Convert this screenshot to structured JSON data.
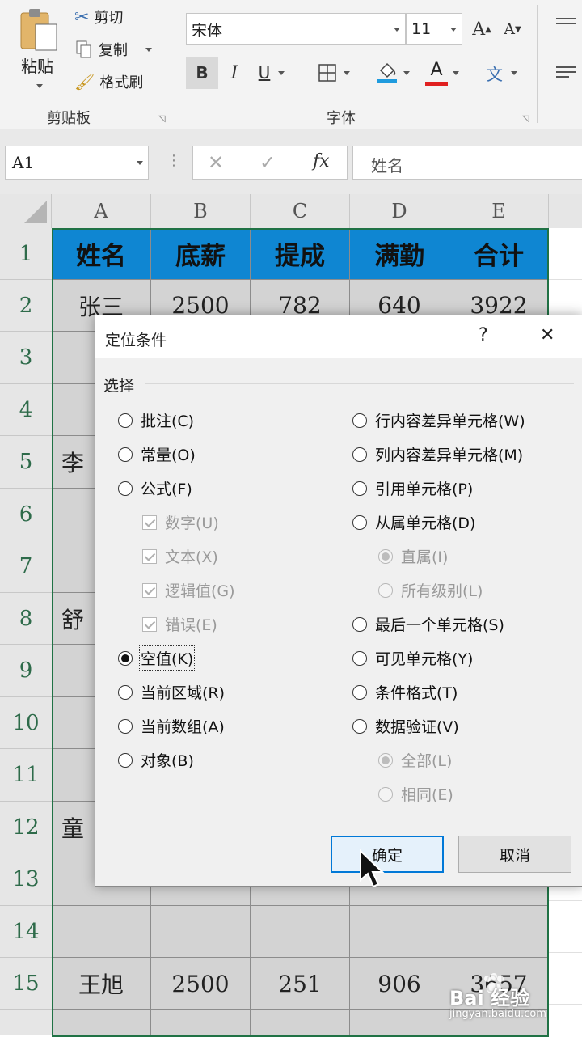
{
  "ribbon": {
    "clipboard": {
      "paste_label": "粘贴",
      "cut_label": "剪切",
      "copy_label": "复制",
      "format_painter_label": "格式刷",
      "group_label": "剪贴板"
    },
    "font": {
      "font_name": "宋体",
      "font_size": "11",
      "grow_label": "A",
      "shrink_label": "A",
      "bold_label": "B",
      "italic_label": "I",
      "underline_label": "U",
      "font_color_label": "A",
      "phonetic_label": "文",
      "group_label": "字体"
    }
  },
  "formula_bar": {
    "name_box": "A1",
    "fx_label": "fx",
    "content": "姓名"
  },
  "sheet": {
    "columns": [
      "A",
      "B",
      "C",
      "D",
      "E"
    ],
    "rows": [
      "1",
      "2",
      "3",
      "4",
      "5",
      "6",
      "7",
      "8",
      "9",
      "10",
      "11",
      "12",
      "13",
      "14",
      "15"
    ],
    "header_cells": [
      "姓名",
      "底薪",
      "提成",
      "满勤",
      "合计"
    ],
    "visible_cells": {
      "r2": [
        "张三",
        "2500",
        "782",
        "640",
        "3922"
      ],
      "r5a": "李",
      "r8a": "舒",
      "r12a": "童",
      "r15": [
        "王旭",
        "2500",
        "251",
        "906",
        "3657"
      ]
    },
    "colors": {
      "header_fill": "#0f86d2",
      "selection_fill": "#d3d3d3",
      "selection_border": "#207245"
    }
  },
  "dialog": {
    "title": "定位条件",
    "help_label": "?",
    "close_label": "✕",
    "section_label": "选择",
    "left_options": [
      {
        "label": "批注(C)",
        "selected": false
      },
      {
        "label": "常量(O)",
        "selected": false
      },
      {
        "label": "公式(F)",
        "selected": false
      },
      {
        "label": "数字(U)",
        "checked": true,
        "disabled": true
      },
      {
        "label": "文本(X)",
        "checked": true,
        "disabled": true
      },
      {
        "label": "逻辑值(G)",
        "checked": true,
        "disabled": true
      },
      {
        "label": "错误(E)",
        "checked": true,
        "disabled": true
      },
      {
        "label": "空值(K)",
        "selected": true
      },
      {
        "label": "当前区域(R)",
        "selected": false
      },
      {
        "label": "当前数组(A)",
        "selected": false
      },
      {
        "label": "对象(B)",
        "selected": false
      }
    ],
    "right_options": [
      {
        "label": "行内容差异单元格(W)",
        "selected": false
      },
      {
        "label": "列内容差异单元格(M)",
        "selected": false
      },
      {
        "label": "引用单元格(P)",
        "selected": false
      },
      {
        "label": "从属单元格(D)",
        "selected": false
      },
      {
        "label": "直属(I)",
        "selected": true,
        "disabled": true
      },
      {
        "label": "所有级别(L)",
        "selected": false,
        "disabled": true
      },
      {
        "label": "最后一个单元格(S)",
        "selected": false
      },
      {
        "label": "可见单元格(Y)",
        "selected": false
      },
      {
        "label": "条件格式(T)",
        "selected": false
      },
      {
        "label": "数据验证(V)",
        "selected": false
      },
      {
        "label": "全部(L)",
        "selected": true,
        "disabled": true
      },
      {
        "label": "相同(E)",
        "selected": false,
        "disabled": true
      }
    ],
    "ok_label": "确定",
    "cancel_label": "取消"
  },
  "watermark": {
    "brand": "Bai 经验",
    "url": "jingyan.baidu.com"
  }
}
